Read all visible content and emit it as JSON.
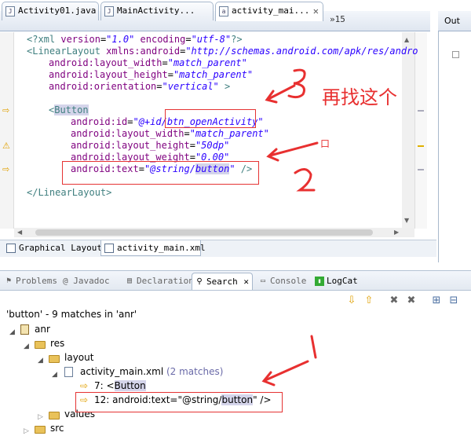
{
  "editor_tabs": [
    {
      "label": "Activity01.java"
    },
    {
      "label": "MainActivity..."
    },
    {
      "label": "activity_mai..."
    }
  ],
  "more_tabs": "»15",
  "outline_label": "Out",
  "code": {
    "line1_tag_open": "<?xml ",
    "line1_attr1": "version",
    "line1_eq": "=",
    "line1_val1": "\"1.0\"",
    "line1_attr2": " encoding",
    "line1_val2": "\"utf-8\"",
    "line1_close": "?>",
    "line2_tag": "<LinearLayout ",
    "line2_attr": "xmlns:android",
    "line2_val": "\"http://schemas.android.com/apk/res/andro",
    "line3_attr": "android:layout_width",
    "line3_val": "\"match_parent\"",
    "line4_attr": "android:layout_height",
    "line4_val": "\"match_parent\"",
    "line5_attr": "android:orientation",
    "line5_val": "\"vertical\"",
    "line5_close": " >",
    "line7_lt": "<",
    "line7_tag": "Button",
    "line8_attr": "android:id",
    "line8_val": "\"@+id/btn_openActivity\"",
    "line9_attr": "android:layout_width",
    "line9_val": "\"match_parent\"",
    "line10_attr": "android:layout_height",
    "line10_val": "\"50dp\"",
    "line11_attr": "android:layout_weight",
    "line11_val": "\"0.00\"",
    "line12_attr": "android:text",
    "line12_val_a": "\"@string/",
    "line12_val_b": "button",
    "line12_val_c": "\"",
    "line12_close": " />",
    "line14": "</LinearLayout>"
  },
  "bottom_tabs": [
    {
      "label": "Graphical Layout"
    },
    {
      "label": "activity_main.xml"
    }
  ],
  "view_tabs": [
    {
      "label": "Problems"
    },
    {
      "label": "@ Javadoc"
    },
    {
      "label": "Declaration"
    },
    {
      "label": "Search"
    },
    {
      "label": "Console"
    },
    {
      "label": "LogCat"
    }
  ],
  "search": {
    "title": "'button' - 9 matches in 'anr'",
    "tree": {
      "project": "anr",
      "res": "res",
      "layout": "layout",
      "file": "activity_main.xml",
      "file_count": "(2 matches)",
      "match1_line": "7: <",
      "match1_word": "Button",
      "match2_line": "12: android:text=\"@string/",
      "match2_word": "button",
      "match2_tail": "\" />",
      "values": "values",
      "src": "src"
    }
  },
  "annotations": {
    "note_chinese": "再找这个",
    "num1": "1",
    "num2": "2",
    "num3": "3",
    "small_box": "口"
  },
  "colors": {
    "annotation_red": "#e83030",
    "xml_tag": "#3f7f7f",
    "xml_attr": "#7f007f",
    "xml_value": "#2a00ff"
  }
}
